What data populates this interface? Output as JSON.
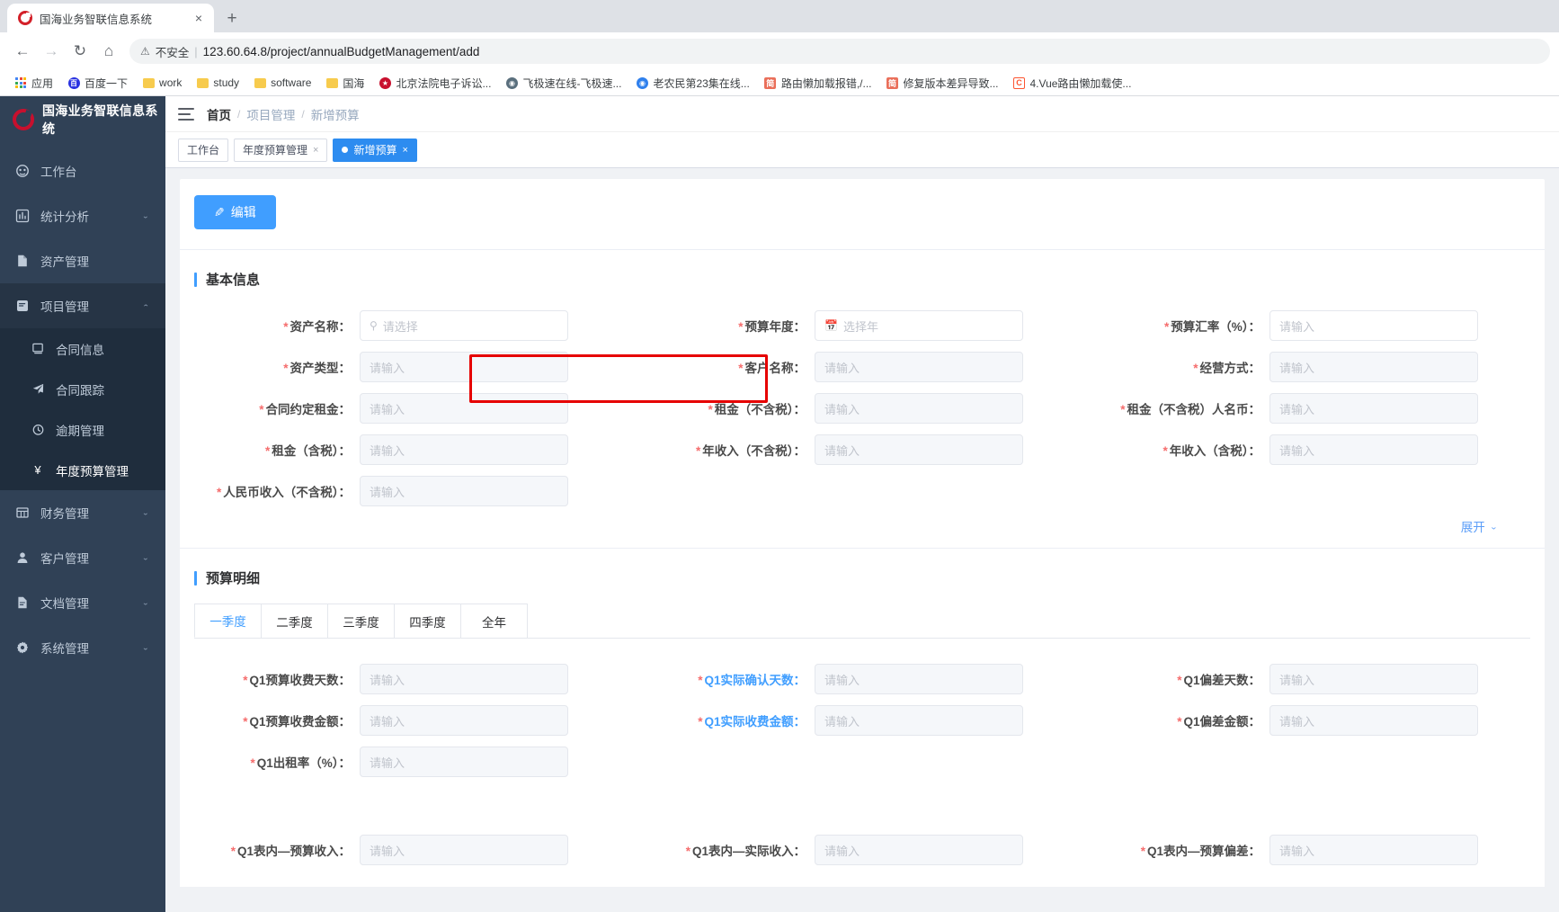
{
  "browser": {
    "tab": {
      "title": "国海业务智联信息系统",
      "close_label": "×",
      "favicon": "guohai-logo-icon"
    },
    "new_tab_label": "+",
    "nav": {
      "back": "←",
      "forward": "→",
      "reload": "↻",
      "home": "⌂"
    },
    "security_label": "不安全",
    "security_icon": "warning-triangle-icon",
    "url": "123.60.64.8/project/annualBudgetManagement/add",
    "bookmarks": [
      {
        "label": "应用",
        "icon": "apps-grid-icon",
        "color": "#4285f4"
      },
      {
        "label": "百度一下",
        "icon": "baidu-icon",
        "color": "#2932e1"
      },
      {
        "label": "work",
        "icon": "folder-icon",
        "color": "#f7cb4d"
      },
      {
        "label": "study",
        "icon": "folder-icon",
        "color": "#f7cb4d"
      },
      {
        "label": "software",
        "icon": "folder-icon",
        "color": "#f7cb4d"
      },
      {
        "label": "国海",
        "icon": "folder-icon",
        "color": "#f7cb4d"
      },
      {
        "label": "北京法院电子诉讼...",
        "icon": "emblem-icon",
        "color": "#c8102e"
      },
      {
        "label": "飞极速在线-飞极速...",
        "icon": "globe-icon",
        "color": "#5a6f7d"
      },
      {
        "label": "老农民第23集在线...",
        "icon": "play-circle-icon",
        "color": "#2f80ed"
      },
      {
        "label": "路由懒加载报错,/...",
        "icon": "jianshu-icon",
        "color": "#ea6f5a"
      },
      {
        "label": "修复版本差异导致...",
        "icon": "jianshu-icon",
        "color": "#ea6f5a"
      },
      {
        "label": "4.Vue路由懒加载使...",
        "icon": "csdn-icon",
        "color": "#fc5531"
      }
    ]
  },
  "sidebar": {
    "logo_text": "国海业务智联信息系统",
    "logo_icon": "guohai-ring-icon",
    "items": [
      {
        "label": "工作台",
        "icon": "dashboard-icon",
        "arrow": "",
        "open": false
      },
      {
        "label": "统计分析",
        "icon": "chart-icon",
        "arrow": "⌄",
        "open": false
      },
      {
        "label": "资产管理",
        "icon": "assets-icon",
        "arrow": "",
        "open": false
      },
      {
        "label": "项目管理",
        "icon": "project-icon",
        "arrow": "⌃",
        "open": true
      },
      {
        "label": "财务管理",
        "icon": "finance-icon",
        "arrow": "⌄",
        "open": false
      },
      {
        "label": "客户管理",
        "icon": "customer-icon",
        "arrow": "⌄",
        "open": false
      },
      {
        "label": "文档管理",
        "icon": "document-icon",
        "arrow": "⌄",
        "open": false
      },
      {
        "label": "系统管理",
        "icon": "gear-icon",
        "arrow": "⌄",
        "open": false
      }
    ],
    "submenu": [
      {
        "label": "合同信息",
        "icon": "contract-icon",
        "active": false
      },
      {
        "label": "合同跟踪",
        "icon": "send-icon",
        "active": false
      },
      {
        "label": "逾期管理",
        "icon": "clock-icon",
        "active": false
      },
      {
        "label": "年度预算管理",
        "icon": "yuan-icon",
        "active": true
      }
    ]
  },
  "topbar": {
    "menu_toggle_icon": "hamburger-icon",
    "breadcrumb": [
      "首页",
      "项目管理",
      "新增预算"
    ],
    "breadcrumb_sep": "/"
  },
  "tagbar": {
    "tags": [
      {
        "label": "工作台",
        "closable": false,
        "active": false
      },
      {
        "label": "年度预算管理",
        "closable": true,
        "active": false
      },
      {
        "label": "新增预算",
        "closable": true,
        "active": true
      }
    ],
    "close_glyph": "×"
  },
  "toolbar": {
    "edit_label": "编辑",
    "edit_icon": "pencil-icon"
  },
  "basic_section": {
    "title": "基本信息",
    "expand_label": "展开",
    "expand_icon": "chevron-down-icon",
    "fields": [
      {
        "label": "资产名称：",
        "placeholder": "请选择",
        "required": true,
        "icon": "search-icon",
        "white": true
      },
      {
        "label": "预算年度：",
        "placeholder": "选择年",
        "required": true,
        "icon": "calendar-icon",
        "white": true
      },
      {
        "label": "预算汇率（%）：",
        "placeholder": "请输入",
        "required": true,
        "icon": "",
        "white": true
      },
      {
        "label": "资产类型：",
        "placeholder": "请输入",
        "required": true,
        "icon": "",
        "white": false
      },
      {
        "label": "客户名称：",
        "placeholder": "请输入",
        "required": true,
        "icon": "",
        "white": false
      },
      {
        "label": "经营方式：",
        "placeholder": "请输入",
        "required": true,
        "icon": "",
        "white": false
      },
      {
        "label": "合同约定租金：",
        "placeholder": "请输入",
        "required": true,
        "icon": "",
        "white": false
      },
      {
        "label": "租金（不含税）：",
        "placeholder": "请输入",
        "required": true,
        "icon": "",
        "white": false,
        "highlighted": true
      },
      {
        "label": "租金（不含税）人名币：",
        "placeholder": "请输入",
        "required": true,
        "icon": "",
        "white": false
      },
      {
        "label": "租金（含税）：",
        "placeholder": "请输入",
        "required": true,
        "icon": "",
        "white": false
      },
      {
        "label": "年收入（不含税）：",
        "placeholder": "请输入",
        "required": true,
        "icon": "",
        "white": false
      },
      {
        "label": "年收入（含税）：",
        "placeholder": "请输入",
        "required": true,
        "icon": "",
        "white": false
      },
      {
        "label": "人民币收入（不含税）：",
        "placeholder": "请输入",
        "required": true,
        "icon": "",
        "white": false
      }
    ]
  },
  "detail_section": {
    "title": "预算明细",
    "tabs": [
      {
        "label": "一季度",
        "active": true
      },
      {
        "label": "二季度",
        "active": false
      },
      {
        "label": "三季度",
        "active": false
      },
      {
        "label": "四季度",
        "active": false
      },
      {
        "label": "全年",
        "active": false
      }
    ],
    "panel1_fields": [
      {
        "label": "Q1预算收费天数：",
        "placeholder": "请输入",
        "required": true,
        "blue": false
      },
      {
        "label": "Q1实际确认天数：",
        "placeholder": "请输入",
        "required": true,
        "blue": true
      },
      {
        "label": "Q1偏差天数：",
        "placeholder": "请输入",
        "required": true,
        "blue": false
      },
      {
        "label": "Q1预算收费金额：",
        "placeholder": "请输入",
        "required": true,
        "blue": false
      },
      {
        "label": "Q1实际收费金额：",
        "placeholder": "请输入",
        "required": true,
        "blue": true
      },
      {
        "label": "Q1偏差金额：",
        "placeholder": "请输入",
        "required": true,
        "blue": false
      },
      {
        "label": "Q1出租率（%）：",
        "placeholder": "请输入",
        "required": true,
        "blue": false
      }
    ],
    "panel2_fields": [
      {
        "label": "Q1表内—预算收入：",
        "placeholder": "请输入",
        "required": true,
        "blue": false
      },
      {
        "label": "Q1表内—实际收入：",
        "placeholder": "请输入",
        "required": true,
        "blue": false
      },
      {
        "label": "Q1表内—预算偏差：",
        "placeholder": "请输入",
        "required": true,
        "blue": false
      }
    ]
  },
  "colors": {
    "accent": "#409eff",
    "sidebar_bg": "#304156",
    "submenu_bg": "#1f2d3d",
    "highlight_border": "#e60000",
    "required_star": "#f56c6c"
  }
}
